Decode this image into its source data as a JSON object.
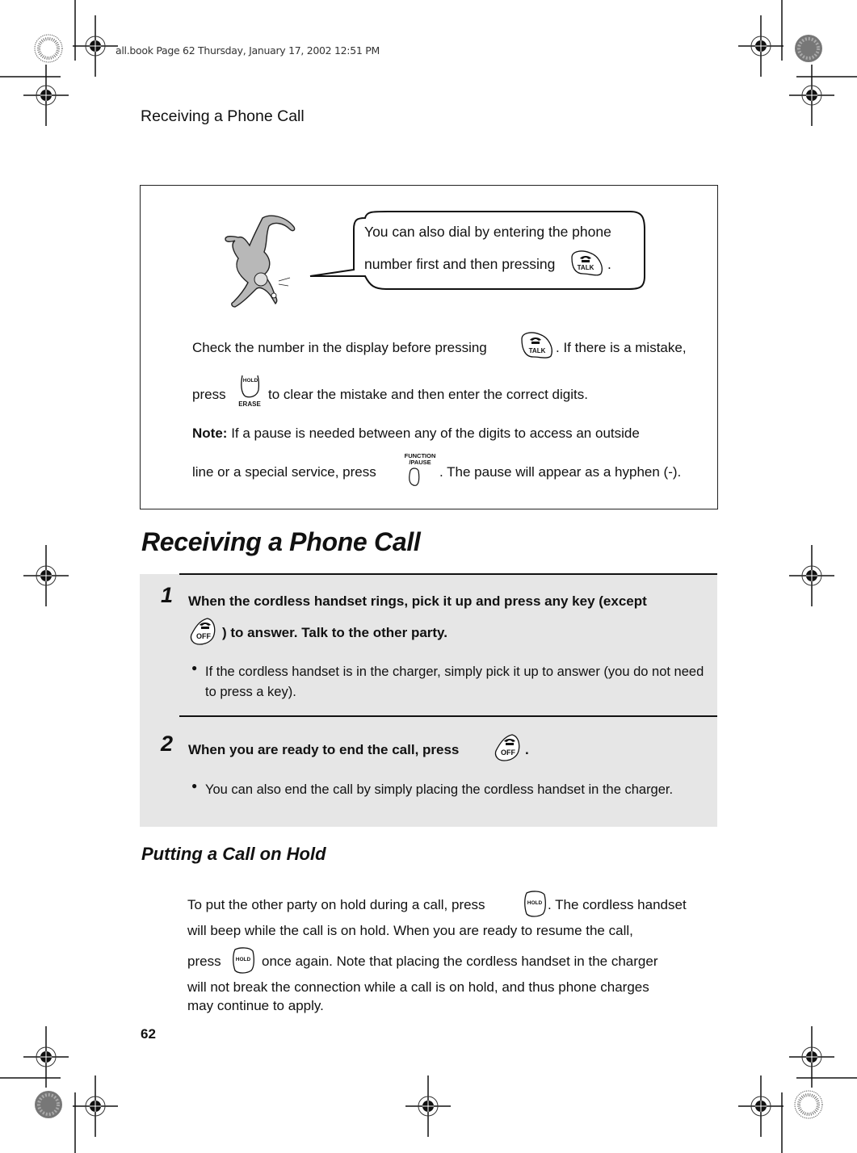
{
  "slug": "all.book  Page 62  Thursday, January 17, 2002  12:51 PM",
  "running_header": "Receiving a Phone Call",
  "tip": {
    "bubble_line1": "You can also dial by entering the phone",
    "bubble_line2_pre": "number first and then pressing",
    "bubble_line2_post": ".",
    "para1_line1_pre": "Check the number in the display before pressing",
    "para1_line1_post": ". If there is a mistake,",
    "para1_line2_pre": "press",
    "para1_line2_post": "to clear the mistake and then enter the correct digits.",
    "note_label": "Note:",
    "note_line1": "If a pause is needed between any of the digits to access an outside",
    "note_line2_pre": "line or a special service, press",
    "note_line2_post": ". The pause will appear as a hyphen (-)."
  },
  "keys": {
    "talk": "TALK",
    "hold": "HOLD",
    "erase": "ERASE",
    "function_pause": "FUNCTION",
    "pause": "/PAUSE",
    "off": "OFF"
  },
  "section_title": "Receiving a Phone Call",
  "steps": [
    {
      "number": "1",
      "line1": "When the cordless handset rings, pick it up and press any key (except",
      "line2_post": ") to answer. Talk to the other party.",
      "bullet": "If the cordless handset is in the charger, simply pick it up to answer (you do not need to press a key)."
    },
    {
      "number": "2",
      "line1_pre": "When you are ready to end the call, press",
      "line1_post": ".",
      "bullet": "You can also end the call by simply placing the cordless handset in the charger."
    }
  ],
  "hold_section": {
    "title": "Putting a Call on Hold",
    "line1_pre": "To put the other party on hold during a call, press",
    "line1_post": ". The cordless handset",
    "line2": "will beep while the call is on hold. When you are ready to resume the call,",
    "line3_pre": "press",
    "line3_post": "once again. Note that placing the cordless handset in the charger",
    "line4": "will not break the connection while a call is on hold, and thus phone charges",
    "line5": "may continue to apply."
  },
  "page_number": "62"
}
